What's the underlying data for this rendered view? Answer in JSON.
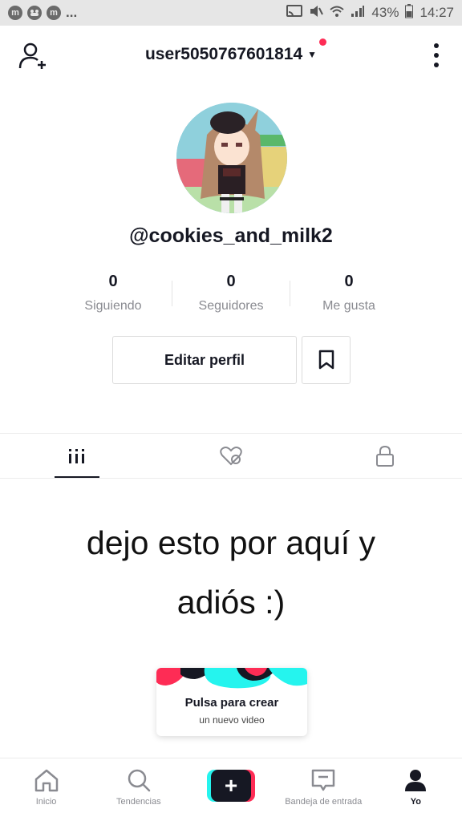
{
  "status_bar": {
    "left_icons": [
      "m",
      "m",
      "m"
    ],
    "ellipsis": "...",
    "battery": "43%",
    "time": "14:27"
  },
  "header": {
    "username": "user5050767601814",
    "has_notification_dot": true
  },
  "profile": {
    "handle": "@cookies_and_milk2",
    "stats": [
      {
        "value": "0",
        "label": "Siguiendo"
      },
      {
        "value": "0",
        "label": "Seguidores"
      },
      {
        "value": "0",
        "label": "Me gusta"
      }
    ],
    "edit_label": "Editar perfil"
  },
  "overlay_caption": {
    "line1": "dejo esto por aquí y",
    "line2": "adiós :)"
  },
  "create_card": {
    "title": "Pulsa para crear",
    "subtitle": "un nuevo video"
  },
  "bottom_nav": {
    "items": [
      {
        "label": "Inicio",
        "icon": "home-icon"
      },
      {
        "label": "Tendencias",
        "icon": "search-icon"
      },
      {
        "label": "",
        "icon": "create-icon"
      },
      {
        "label": "Bandeja de entrada",
        "icon": "inbox-icon"
      },
      {
        "label": "Yo",
        "icon": "profile-icon"
      }
    ]
  },
  "colors": {
    "accent_red": "#fe2c55",
    "accent_cyan": "#25f4ee",
    "text_primary": "#161823",
    "text_secondary": "#8a8b91"
  }
}
